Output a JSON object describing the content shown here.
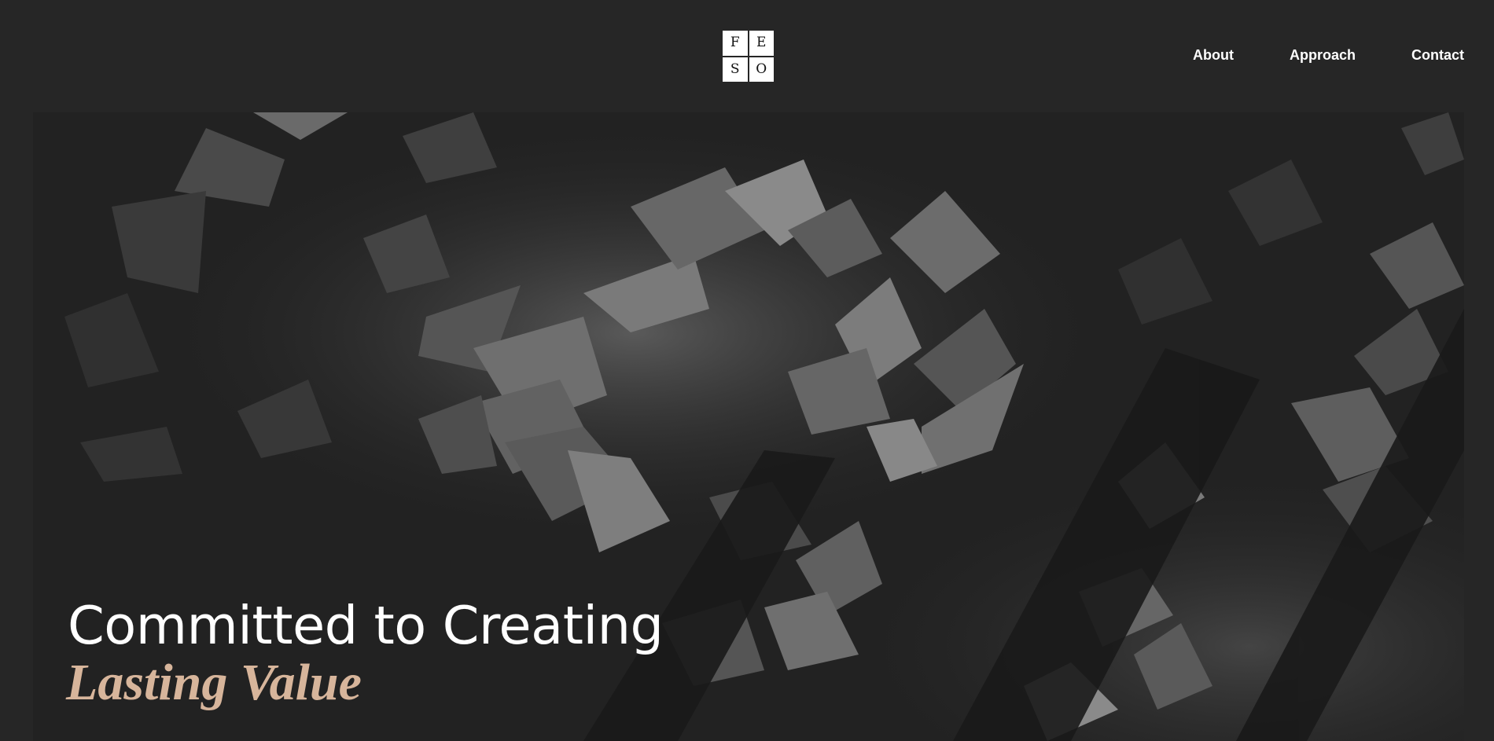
{
  "logo": {
    "letters": [
      "F",
      "E",
      "S",
      "O"
    ]
  },
  "nav": {
    "items": [
      "About",
      "Approach",
      "Contact"
    ]
  },
  "hero": {
    "headline": "Committed to Creating",
    "accent": "Lasting Value"
  },
  "colors": {
    "background": "#262626",
    "text": "#ffffff",
    "accent": "#d7b59b"
  }
}
